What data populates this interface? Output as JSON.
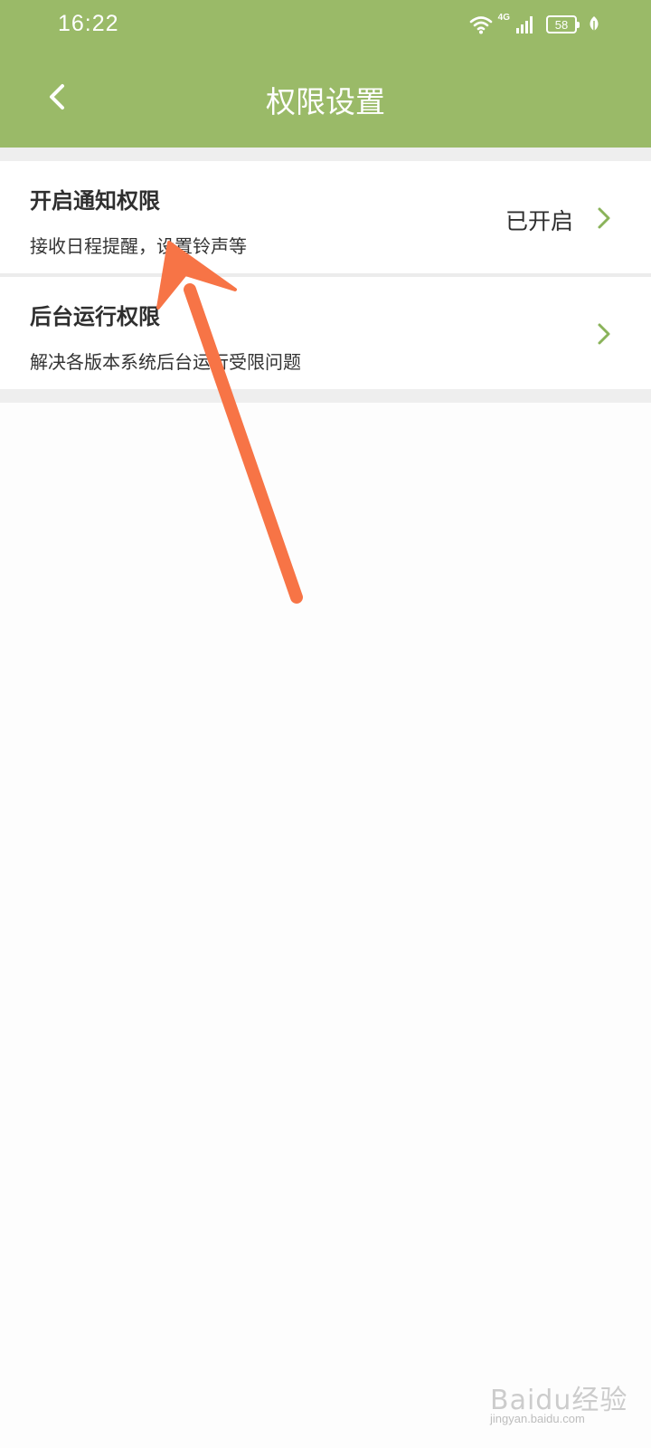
{
  "status_bar": {
    "time": "16:22",
    "network": "4G",
    "battery": "58",
    "icons": [
      "wifi-icon",
      "signal-icon",
      "battery-icon",
      "leaf-icon"
    ]
  },
  "header": {
    "title": "权限设置",
    "back_icon": "chevron-left-icon"
  },
  "settings": {
    "items": [
      {
        "title": "开启通知权限",
        "subtitle": "接收日程提醒，设置铃声等",
        "status": "已开启"
      },
      {
        "title": "后台运行权限",
        "subtitle": "解决各版本系统后台运行受限问题",
        "status": ""
      }
    ]
  },
  "watermark": {
    "brand": "Baidu经验",
    "url": "jingyan.baidu.com"
  },
  "colors": {
    "header_bg": "#9aba68",
    "accent_green": "#8ab35a",
    "annotation_arrow": "#f77446",
    "text_primary": "#2f2f2f"
  }
}
